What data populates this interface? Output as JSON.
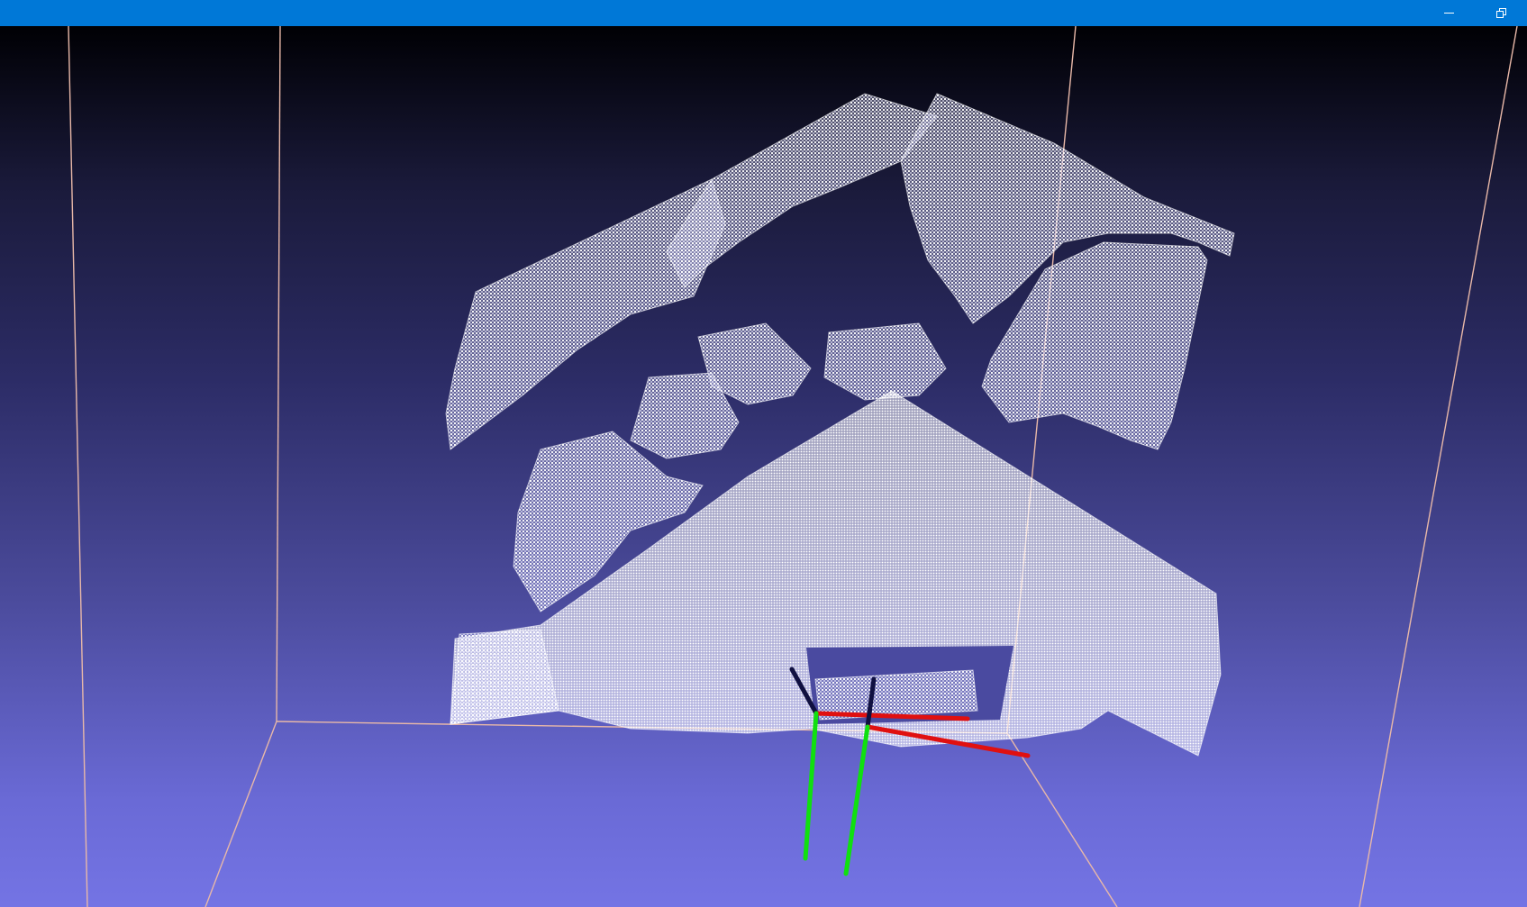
{
  "window": {
    "title": "",
    "minimize_label": "minimize",
    "restore_label": "restore"
  },
  "viewport": {
    "background_top": "#000004",
    "background_bottom": "#7474e4",
    "bounding_box_color": "#e8b8a8",
    "point_cloud_color": "#f2f2ff",
    "axis_colors": {
      "x": "#e01010",
      "y": "#10e010",
      "z": "#101040"
    },
    "content": "point-cloud-with-two-camera-axes"
  }
}
